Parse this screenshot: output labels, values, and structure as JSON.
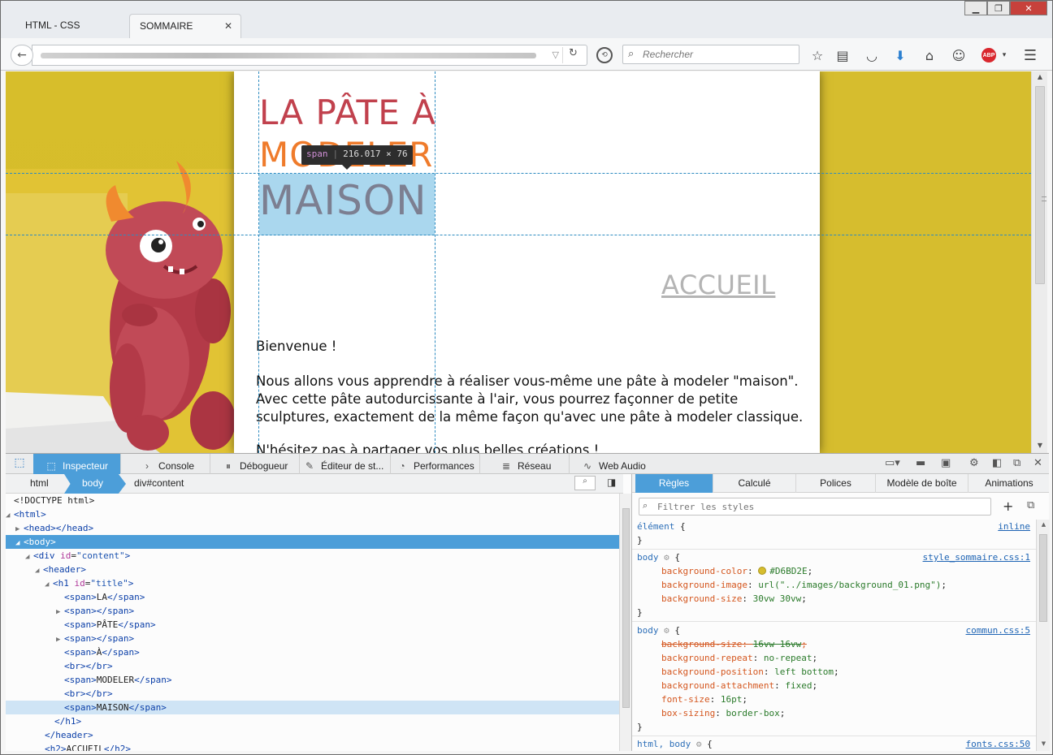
{
  "browser": {
    "tabs": [
      {
        "label": "HTML - CSS",
        "active": false
      },
      {
        "label": "SOMMAIRE",
        "active": true
      }
    ],
    "search_placeholder": "Rechercher",
    "abp_label": "ABP"
  },
  "page": {
    "background_color": "#D6BD2E",
    "title_line1": "LA PÂTE À",
    "title_line2": "MODELER",
    "title_line3": "MAISON",
    "tooltip": {
      "tag": "span",
      "width": "216.017",
      "times": "×",
      "height": "76"
    },
    "nav_heading": "ACCUEIL",
    "para1": "Bienvenue !",
    "para2": "Nous allons vous apprendre à réaliser vous-même une pâte à modeler \"maison\". Avec cette pâte autodurcissante à l'air, vous pourrez façonner de petite sculptures, exactement de la même façon qu'avec une pâte à modeler classique.",
    "para3": "N'hésitez pas à partager vos plus belles créations !"
  },
  "devtools": {
    "tabs": [
      {
        "label": "Inspecteur",
        "icon": "inspector-icon"
      },
      {
        "label": "Console",
        "icon": "console-icon"
      },
      {
        "label": "Débogueur",
        "icon": "debugger-icon"
      },
      {
        "label": "Éditeur de st...",
        "icon": "style-editor-icon"
      },
      {
        "label": "Performances",
        "icon": "performance-icon"
      },
      {
        "label": "Réseau",
        "icon": "network-icon"
      },
      {
        "label": "Web Audio",
        "icon": "web-audio-icon"
      }
    ],
    "breadcrumbs": [
      "html",
      "body",
      "div#content"
    ],
    "sidebar_tabs": [
      "Règles",
      "Calculé",
      "Polices",
      "Modèle de boîte",
      "Animations"
    ],
    "filter_placeholder": "Filtrer les styles"
  },
  "markup": {
    "doctype": "<!DOCTYPE html>",
    "html": "html",
    "head": "head",
    "body": "body",
    "div_tag": "div",
    "div_attr": "id",
    "div_val": "\"content\"",
    "header": "header",
    "h1": "h1",
    "h1_attr": "id",
    "h1_val": "\"title\"",
    "span": "span",
    "span_texts": [
      "LA",
      "",
      "PÂTE",
      "",
      "À",
      "",
      "MODELER",
      "",
      "MAISON"
    ],
    "br": "br",
    "h2": "h2",
    "h2_text": "ACCUEIL"
  },
  "rules": {
    "element": {
      "selector": "élément",
      "source": "inline"
    },
    "rule1": {
      "selector": "body",
      "source": "style_sommaire.css:1",
      "props": [
        {
          "name": "background-color",
          "value": "#D6BD2E",
          "swatch": "#D6BD2E"
        },
        {
          "name": "background-image",
          "value": "url(\"../images/background_01.png\")"
        },
        {
          "name": "background-size",
          "value": "30vw 30vw"
        }
      ]
    },
    "rule2": {
      "selector": "body",
      "source": "commun.css:5",
      "props": [
        {
          "name": "background-size",
          "value": "16vw 16vw",
          "overridden": true
        },
        {
          "name": "background-repeat",
          "value": "no-repeat"
        },
        {
          "name": "background-position",
          "value": "left bottom"
        },
        {
          "name": "background-attachment",
          "value": "fixed"
        },
        {
          "name": "font-size",
          "value": "16pt"
        },
        {
          "name": "box-sizing",
          "value": "border-box"
        }
      ]
    },
    "rule3": {
      "selector": "html, body",
      "source": "fonts.css:50"
    }
  }
}
